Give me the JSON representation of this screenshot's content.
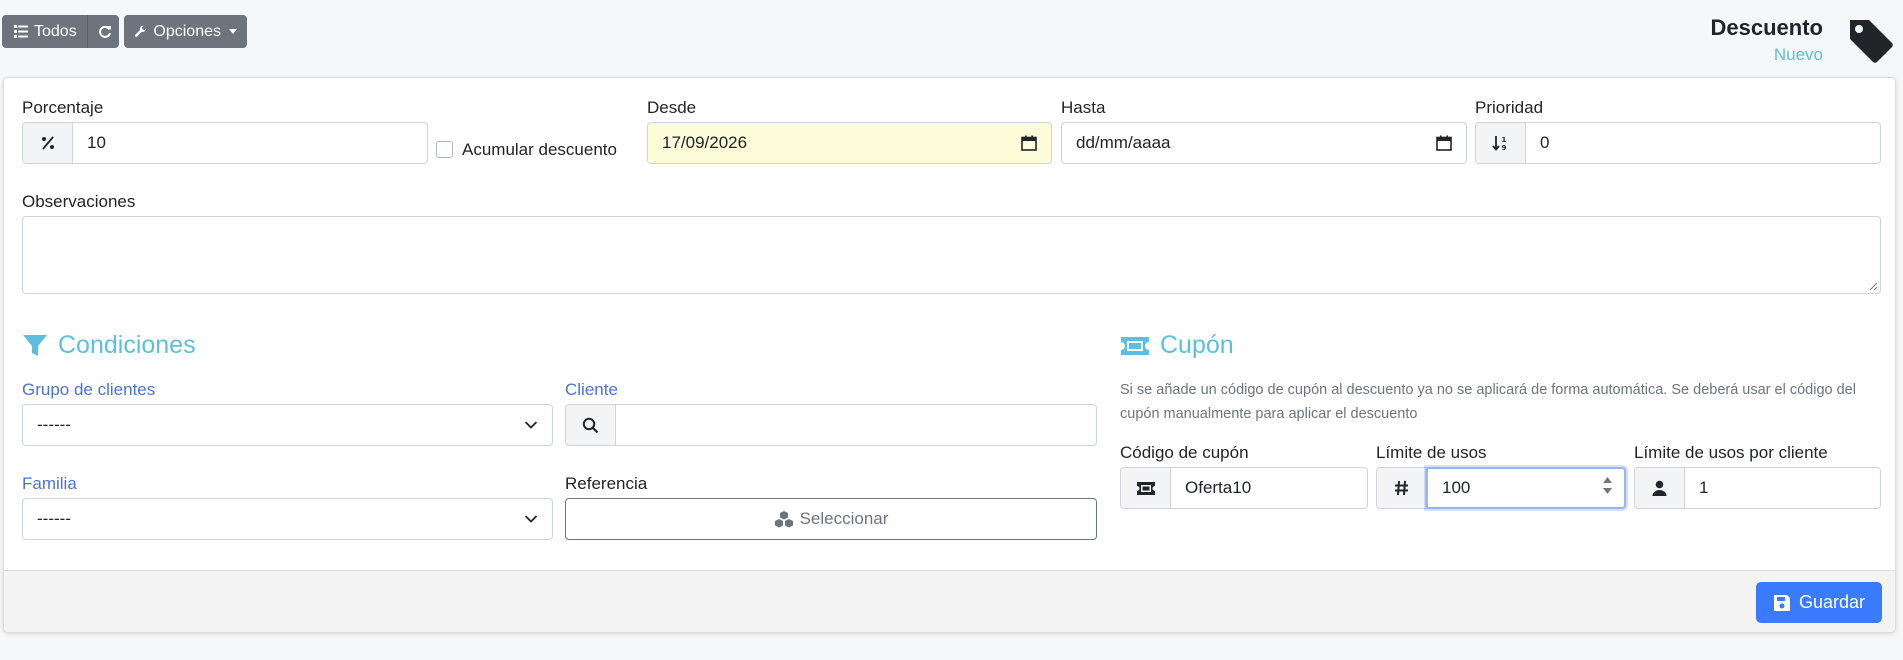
{
  "toolbar": {
    "all_label": "Todos",
    "options_label": "Opciones"
  },
  "header": {
    "title": "Descuento",
    "subtitle": "Nuevo"
  },
  "form": {
    "percentage_label": "Porcentaje",
    "percentage_value": "10",
    "accumulate_label": "Acumular descuento",
    "from_label": "Desde",
    "from_value": "17/09/2026",
    "to_label": "Hasta",
    "to_value": "dd/mm/aaaa",
    "priority_label": "Prioridad",
    "priority_value": "0",
    "notes_label": "Observaciones"
  },
  "conditions": {
    "title": "Condiciones",
    "customer_group_label": "Grupo de clientes",
    "customer_group_value": "------",
    "customer_label": "Cliente",
    "family_label": "Familia",
    "family_value": "------",
    "reference_label": "Referencia",
    "select_button": "Seleccionar"
  },
  "coupon": {
    "title": "Cupón",
    "help": "Si se añade un código de cupón al descuento ya no se aplicará de forma automática. Se deberá usar el código del cupón manualmente para aplicar el descuento",
    "code_label": "Código de cupón",
    "code_value": "Oferta10",
    "usage_limit_label": "Límite de usos",
    "usage_limit_value": "100",
    "usage_per_customer_label": "Límite de usos por cliente",
    "usage_per_customer_value": "1"
  },
  "footer": {
    "save_label": "Guardar"
  },
  "colors": {
    "accent": "#5bc0de",
    "primary": "#3a7bfd",
    "label_blue": "#4a72d9"
  }
}
